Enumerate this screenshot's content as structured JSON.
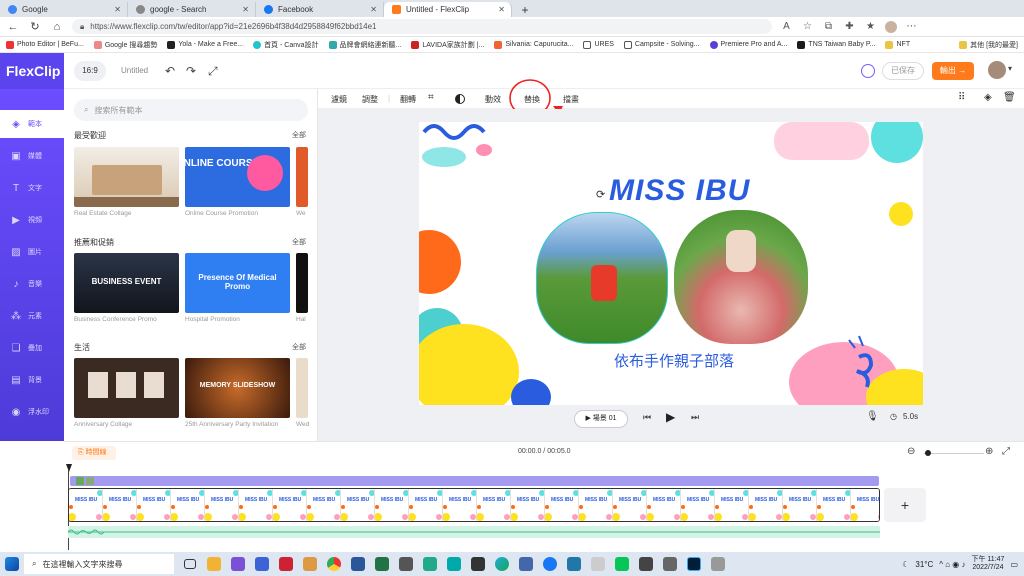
{
  "browser": {
    "tabs": [
      {
        "label": "Google",
        "color": "#4285f4"
      },
      {
        "label": "google - Search",
        "color": "#888888"
      },
      {
        "label": "Facebook",
        "color": "#1877f2"
      },
      {
        "label": "Untitled - FlexClip",
        "color": "#ff7a1a"
      }
    ],
    "new_tab": "+",
    "url": "https://www.flexclip.com/tw/editor/app?id=21e2696b4f38d4d2958849f62bbd14e1",
    "bookmarks": [
      "Photo Editor | BeFu...",
      "Google 搜尋趨勢",
      "Yola - Make a Free...",
      "首頁 - Canva設計",
      "品牌會網絡連新聽...",
      "LAVIDA家族計劃 |...",
      "Silvania: Capurucita...",
      "URES",
      "Campsite - Solving...",
      "Premiere Pro and A...",
      "TNS Taiwan Baby P...",
      "NFT"
    ],
    "other_bookmarks": "其他 [我的最愛]"
  },
  "app": {
    "logo": "FlexClip",
    "ratio": "16:9",
    "title": "Untitled",
    "save": "已保存",
    "export": "輸出 →",
    "accent": "#6c4dff",
    "export_color": "#ff7a1a"
  },
  "sidebar": [
    {
      "label": "範本",
      "icon": "layers-icon"
    },
    {
      "label": "媒體",
      "icon": "media-icon"
    },
    {
      "label": "文字",
      "icon": "text-icon"
    },
    {
      "label": "視頻",
      "icon": "video-icon"
    },
    {
      "label": "圖片",
      "icon": "image-icon"
    },
    {
      "label": "音樂",
      "icon": "music-icon"
    },
    {
      "label": "元素",
      "icon": "elements-icon"
    },
    {
      "label": "疊加",
      "icon": "overlay-icon"
    },
    {
      "label": "背景",
      "icon": "background-icon"
    },
    {
      "label": "浮水印",
      "icon": "watermark-icon"
    }
  ],
  "panel": {
    "search_placeholder": "搜索所有範本",
    "all_label": "全部",
    "sections": [
      {
        "title": "最受歡迎",
        "items": [
          {
            "caption": "Real Estate Collage",
            "thumb_text": ""
          },
          {
            "caption": "Online Course Promotion",
            "thumb_text": "ONLINE COURSE"
          },
          {
            "caption": "We"
          }
        ]
      },
      {
        "title": "推薦和促銷",
        "items": [
          {
            "caption": "Business Conference Promo",
            "thumb_text": "BUSINESS EVENT"
          },
          {
            "caption": "Hospital Promotion",
            "thumb_text": "Presence Of Medical Promo"
          },
          {
            "caption": "Hal"
          }
        ]
      },
      {
        "title": "生活",
        "items": [
          {
            "caption": "Anniversary Collage",
            "thumb_text": ""
          },
          {
            "caption": "25th Anniversary Party Invitation",
            "thumb_text": "MEMORY SLIDESHOW"
          },
          {
            "caption": "Wed"
          }
        ]
      }
    ]
  },
  "toolbar": {
    "items": [
      "濾鏡",
      "調整",
      "翻轉",
      "",
      "",
      "動效",
      "替換",
      "擋畫"
    ]
  },
  "canvas": {
    "headline": "MISS IBU",
    "subtitle": "依布手作親子部落"
  },
  "player": {
    "scene": "▶ 場景 01",
    "duration": "5.0s"
  },
  "timeline": {
    "label": "時間線",
    "time": "00:00.0 / 00:05.0",
    "add": "+"
  },
  "taskbar": {
    "search": "在這裡輸入文字來搜尋",
    "weather": "31°C",
    "time": "下午 11:47",
    "date": "2022/7/24"
  }
}
